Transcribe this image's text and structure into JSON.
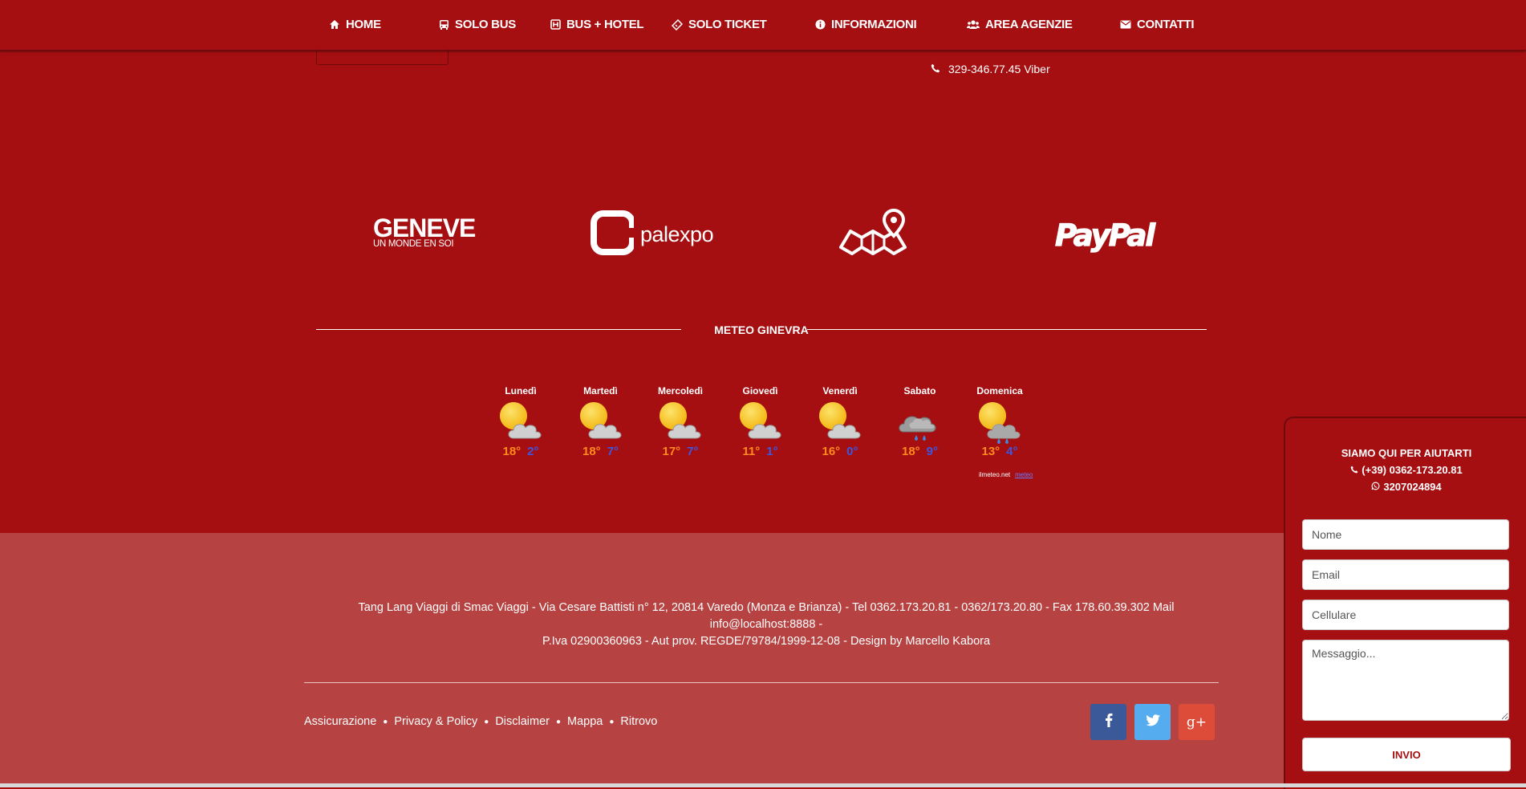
{
  "nav": {
    "items": [
      {
        "label": "HOME",
        "icon": "home-icon"
      },
      {
        "label": "SOLO BUS",
        "icon": "bus-icon"
      },
      {
        "label": "BUS + HOTEL",
        "icon": "hotel-icon"
      },
      {
        "label": "SOLO TICKET",
        "icon": "ticket-icon"
      },
      {
        "label": "INFORMAZIONI",
        "icon": "info-icon"
      },
      {
        "label": "AREA AGENZIE",
        "icon": "users-icon"
      },
      {
        "label": "CONTATTI",
        "icon": "envelope-icon"
      }
    ]
  },
  "contact": {
    "phone_viber": "329-346.77.45 Viber"
  },
  "logos": {
    "geneve_title": "GENEVE",
    "geneve_subtitle": "UN MONDE EN SOI",
    "palexpo": "palexpo",
    "paypal": "PayPal"
  },
  "meteo": {
    "title": "METEO GINEVRA",
    "days": [
      {
        "name": "Lunedì",
        "max": "18°",
        "min": "2°",
        "icon": "partly-cloudy-icon"
      },
      {
        "name": "Martedì",
        "max": "18°",
        "min": "7°",
        "icon": "partly-cloudy-icon"
      },
      {
        "name": "Mercoledì",
        "max": "17°",
        "min": "7°",
        "icon": "partly-cloudy-icon"
      },
      {
        "name": "Giovedì",
        "max": "11°",
        "min": "1°",
        "icon": "partly-cloudy-icon"
      },
      {
        "name": "Venerdì",
        "max": "16°",
        "min": "0°",
        "icon": "partly-cloudy-icon"
      },
      {
        "name": "Sabato",
        "max": "18°",
        "min": "9°",
        "icon": "rain-icon"
      },
      {
        "name": "Domenica",
        "max": "13°",
        "min": "4°",
        "icon": "sun-rain-icon"
      }
    ],
    "credit": "ilmeteo.net",
    "more_link": "meteo"
  },
  "footer": {
    "address_line1": "Tang Lang Viaggi di Smac Viaggi - Via Cesare Battisti n° 12, 20814 Varedo (Monza e Brianza) - Tel 0362.173.20.81 - 0362/173.20.80 - Fax 178.60.39.302 Mail info@localhost:8888 -",
    "address_line2": "P.Iva 02900360963 - Aut prov. REGDE/79784/1999-12-08 - Design by Marcello Kabora",
    "links": [
      "Assicurazione",
      "Privacy & Policy",
      "Disclaimer",
      "Mappa",
      "Ritrovo"
    ],
    "social": [
      {
        "name": "facebook",
        "color": "#3b5998"
      },
      {
        "name": "twitter",
        "color": "#55acee"
      },
      {
        "name": "google-plus",
        "color": "#dd4b39"
      }
    ]
  },
  "panel": {
    "title": "SIAMO QUI PER AIUTARTI",
    "phone": "(+39) 0362-173.20.81",
    "whatsapp": "3207024894",
    "name_placeholder": "Nome",
    "email_placeholder": "Email",
    "mobile_placeholder": "Cellulare",
    "message_placeholder": "Messaggio...",
    "submit_label": "INVIO"
  },
  "colors": {
    "brand_red": "#a50f12",
    "footer_red": "#b74242",
    "temp_max": "#ff8a1c",
    "temp_min": "#3c57e0"
  }
}
